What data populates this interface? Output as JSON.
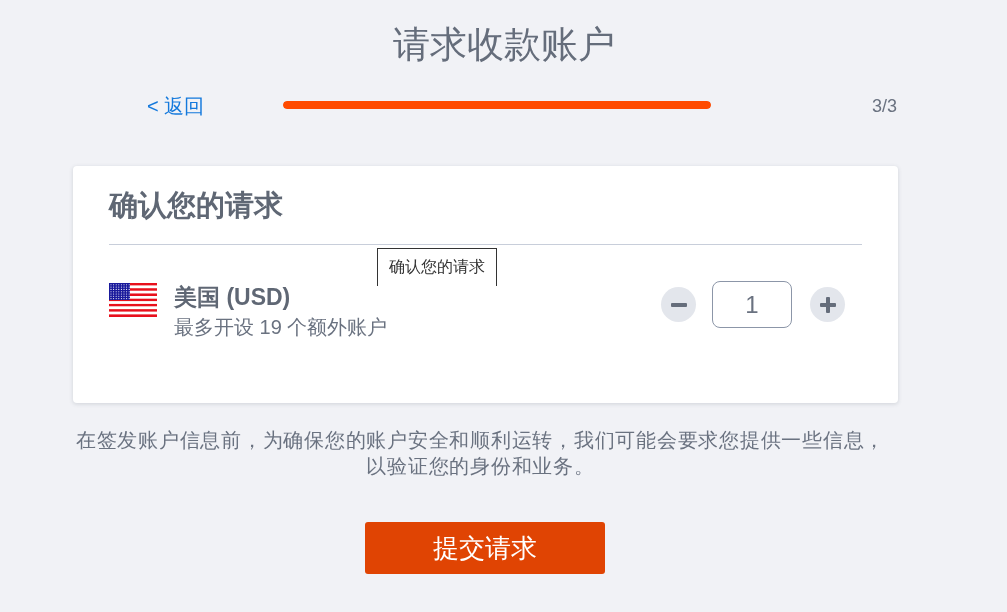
{
  "page": {
    "title": "请求收款账户"
  },
  "progress": {
    "back_link": "< 返回",
    "level": 1,
    "step": "3/3"
  },
  "card": {
    "title": "确认您的请求",
    "accounts": [
      {
        "name": "美国 (USD)",
        "note": "最多开设 19 个额外账户",
        "quantity": "1"
      }
    ]
  },
  "tooltip": {
    "text": "确认您的请求"
  },
  "notice": "在签发账户信息前，为确保您的账户安全和顺利运转，我们可能会要求您提供一些信息，以验证您的身份和业务。",
  "submit_button": "提交请求"
}
